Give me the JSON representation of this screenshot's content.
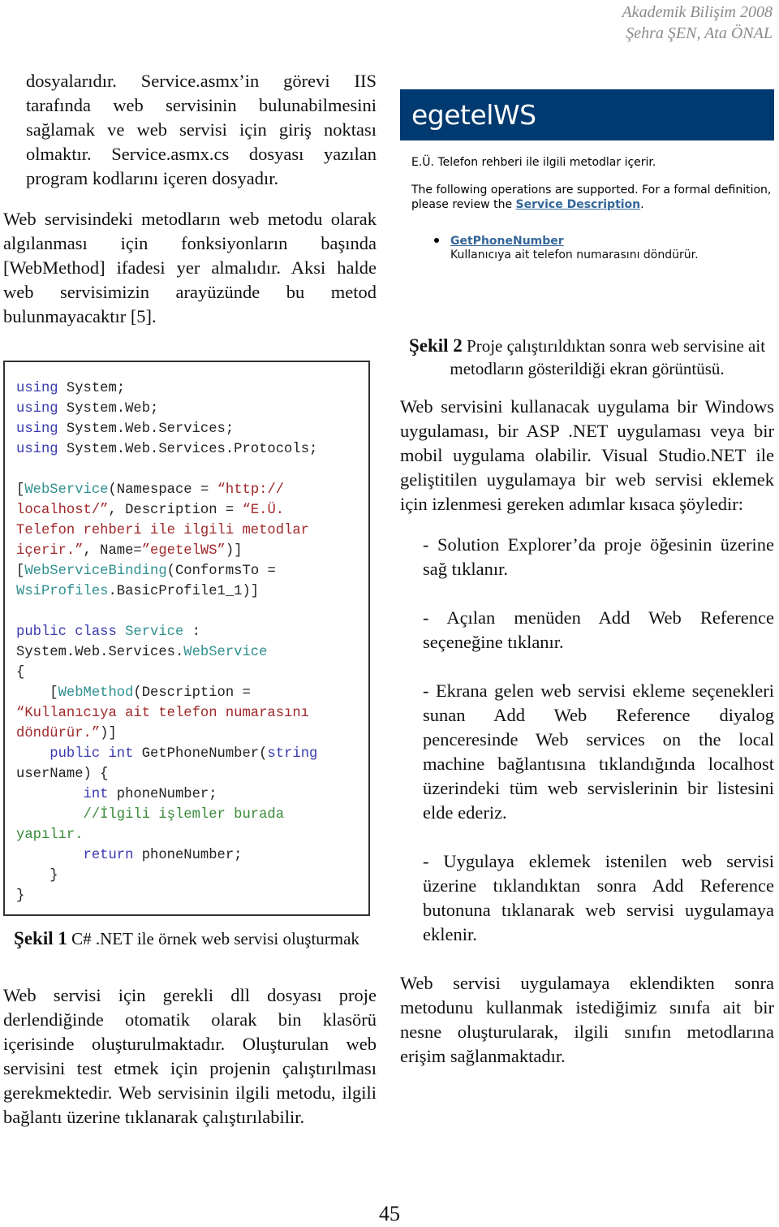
{
  "header": {
    "conference": "Akademik Bilişim 2008",
    "authors": "Şehra ŞEN, Ata ÖNAL"
  },
  "left_column": {
    "para1": "dosyalarıdır. Service.asmx’in görevi IIS tarafında web servisinin bulunabilmesini sağlamak ve web servisi için giriş noktası olmaktır. Service.asmx.cs dosyası yazılan program kodlarını içeren dosyadır.",
    "para2": "Web servisindeki metodların web metodu olarak algılanması için fonksiyonların başında [WebMethod] ifadesi yer almalıdır. Aksi halde web servisimizin arayüzünde  bu metod bulunmayacaktır [5].",
    "para3": "Web servisi için gerekli dll dosyası proje derlendiğinde otomatik olarak bin klasörü içerisinde oluşturulmaktadır. Oluşturulan web servisini test etmek için projenin çalıştırılması gerekmektedir. Web servisinin ilgili metodu, ilgili bağlantı üzerine tıklanarak çalıştırılabilir."
  },
  "figure1": {
    "code_lines": [
      [
        {
          "t": "using",
          "c": "kw"
        },
        {
          "t": " System;",
          "c": ""
        }
      ],
      [
        {
          "t": "using",
          "c": "kw"
        },
        {
          "t": " System.Web;",
          "c": ""
        }
      ],
      [
        {
          "t": "using",
          "c": "kw"
        },
        {
          "t": " System.Web.Services;",
          "c": ""
        }
      ],
      [
        {
          "t": "using",
          "c": "kw"
        },
        {
          "t": " System.Web.Services.Protocols;",
          "c": ""
        }
      ],
      [
        {
          "t": "",
          "c": ""
        }
      ],
      [
        {
          "t": "[",
          "c": ""
        },
        {
          "t": "WebService",
          "c": "ty"
        },
        {
          "t": "(Namespace = ",
          "c": ""
        },
        {
          "t": "“http://",
          "c": "st"
        }
      ],
      [
        {
          "t": "localhost/”",
          "c": "st"
        },
        {
          "t": ", Description = ",
          "c": ""
        },
        {
          "t": "“E.Ü.",
          "c": "st"
        }
      ],
      [
        {
          "t": "Telefon rehberi ile ilgili metodlar",
          "c": "st"
        }
      ],
      [
        {
          "t": "içerir.”",
          "c": "st"
        },
        {
          "t": ", Name=",
          "c": ""
        },
        {
          "t": "”egetelWS”",
          "c": "st"
        },
        {
          "t": ")]",
          "c": ""
        }
      ],
      [
        {
          "t": "[",
          "c": ""
        },
        {
          "t": "WebServiceBinding",
          "c": "ty"
        },
        {
          "t": "(ConformsTo =",
          "c": ""
        }
      ],
      [
        {
          "t": "WsiProfiles",
          "c": "ty"
        },
        {
          "t": ".BasicProfile1_1)]",
          "c": ""
        }
      ],
      [
        {
          "t": "",
          "c": ""
        }
      ],
      [
        {
          "t": "public class",
          "c": "kw"
        },
        {
          "t": " ",
          "c": ""
        },
        {
          "t": "Service",
          "c": "ty"
        },
        {
          "t": " :",
          "c": ""
        }
      ],
      [
        {
          "t": "System.Web.Services.",
          "c": ""
        },
        {
          "t": "WebService",
          "c": "ty"
        }
      ],
      [
        {
          "t": "{",
          "c": ""
        }
      ],
      [
        {
          "t": "    [",
          "c": ""
        },
        {
          "t": "WebMethod",
          "c": "ty"
        },
        {
          "t": "(Description =",
          "c": ""
        }
      ],
      [
        {
          "t": "“Kullanıcıya ait telefon numarasını",
          "c": "st"
        }
      ],
      [
        {
          "t": "döndürür.”",
          "c": "st"
        },
        {
          "t": ")]",
          "c": ""
        }
      ],
      [
        {
          "t": "    public int",
          "c": "kw"
        },
        {
          "t": " GetPhoneNumber(",
          "c": ""
        },
        {
          "t": "string",
          "c": "kw"
        }
      ],
      [
        {
          "t": "userName) {",
          "c": ""
        }
      ],
      [
        {
          "t": "        int",
          "c": "kw"
        },
        {
          "t": " phoneNumber;",
          "c": ""
        }
      ],
      [
        {
          "t": "        //İlgili işlemler burada",
          "c": "cm"
        }
      ],
      [
        {
          "t": "yapılır.",
          "c": "cm"
        }
      ],
      [
        {
          "t": "        return",
          "c": "kw"
        },
        {
          "t": " phoneNumber;",
          "c": ""
        }
      ],
      [
        {
          "t": "    }",
          "c": ""
        }
      ],
      [
        {
          "t": "}",
          "c": ""
        }
      ]
    ],
    "caption_label": "Şekil 1",
    "caption_text": " C# .NET ile örnek web servisi oluşturmak"
  },
  "figure2": {
    "service_name": "egetelWS",
    "service_description": "E.Ü. Telefon rehberi ile ilgili metodlar içerir.",
    "operations_intro": "The following operations are supported. For a formal definition, please review the ",
    "service_description_link": "Service Description",
    "operations_intro_end": ".",
    "operations": [
      {
        "name": "GetPhoneNumber",
        "description": "Kullanıcıya ait telefon numarasını döndürür."
      }
    ],
    "caption_label": "Şekil 2",
    "caption_text": " Proje çalıştırıldıktan sonra web servisine ait metodların gösterildiği ekran görüntüsü."
  },
  "right_column": {
    "para1": "Web servisini kullanacak uygulama bir Windows uygulaması, bir ASP .NET uygulaması veya bir mobil uygulama olabilir. Visual Studio.NET ile geliştitilen uygulamaya bir web servisi eklemek için izlenmesi gereken adımlar kısaca şöyledir:",
    "steps": [
      "-  Solution Explorer’da proje öğesinin üzerine sağ tıklanır.",
      "-  Açılan menüden Add Web Reference seçeneğine tıklanır.",
      "-  Ekrana gelen web servisi ekleme seçenekleri sunan Add Web Reference diyalog penceresinde Web services on the local machine bağlantısına tıklandığında localhost üzerindeki tüm web servislerinin bir listesini elde ederiz.",
      "-  Uygulaya eklemek istenilen web servisi üzerine tıklandıktan sonra Add Reference butonuna tıklanarak web servisi uygulamaya eklenir."
    ],
    "para2": "Web servisi uygulamaya eklendikten sonra metodunu kullanmak istediğimiz sınıfa ait bir nesne oluşturularak, ilgili sınıfın metodlarına erişim sağlanmaktadır."
  },
  "footer": {
    "page_number": "45"
  }
}
